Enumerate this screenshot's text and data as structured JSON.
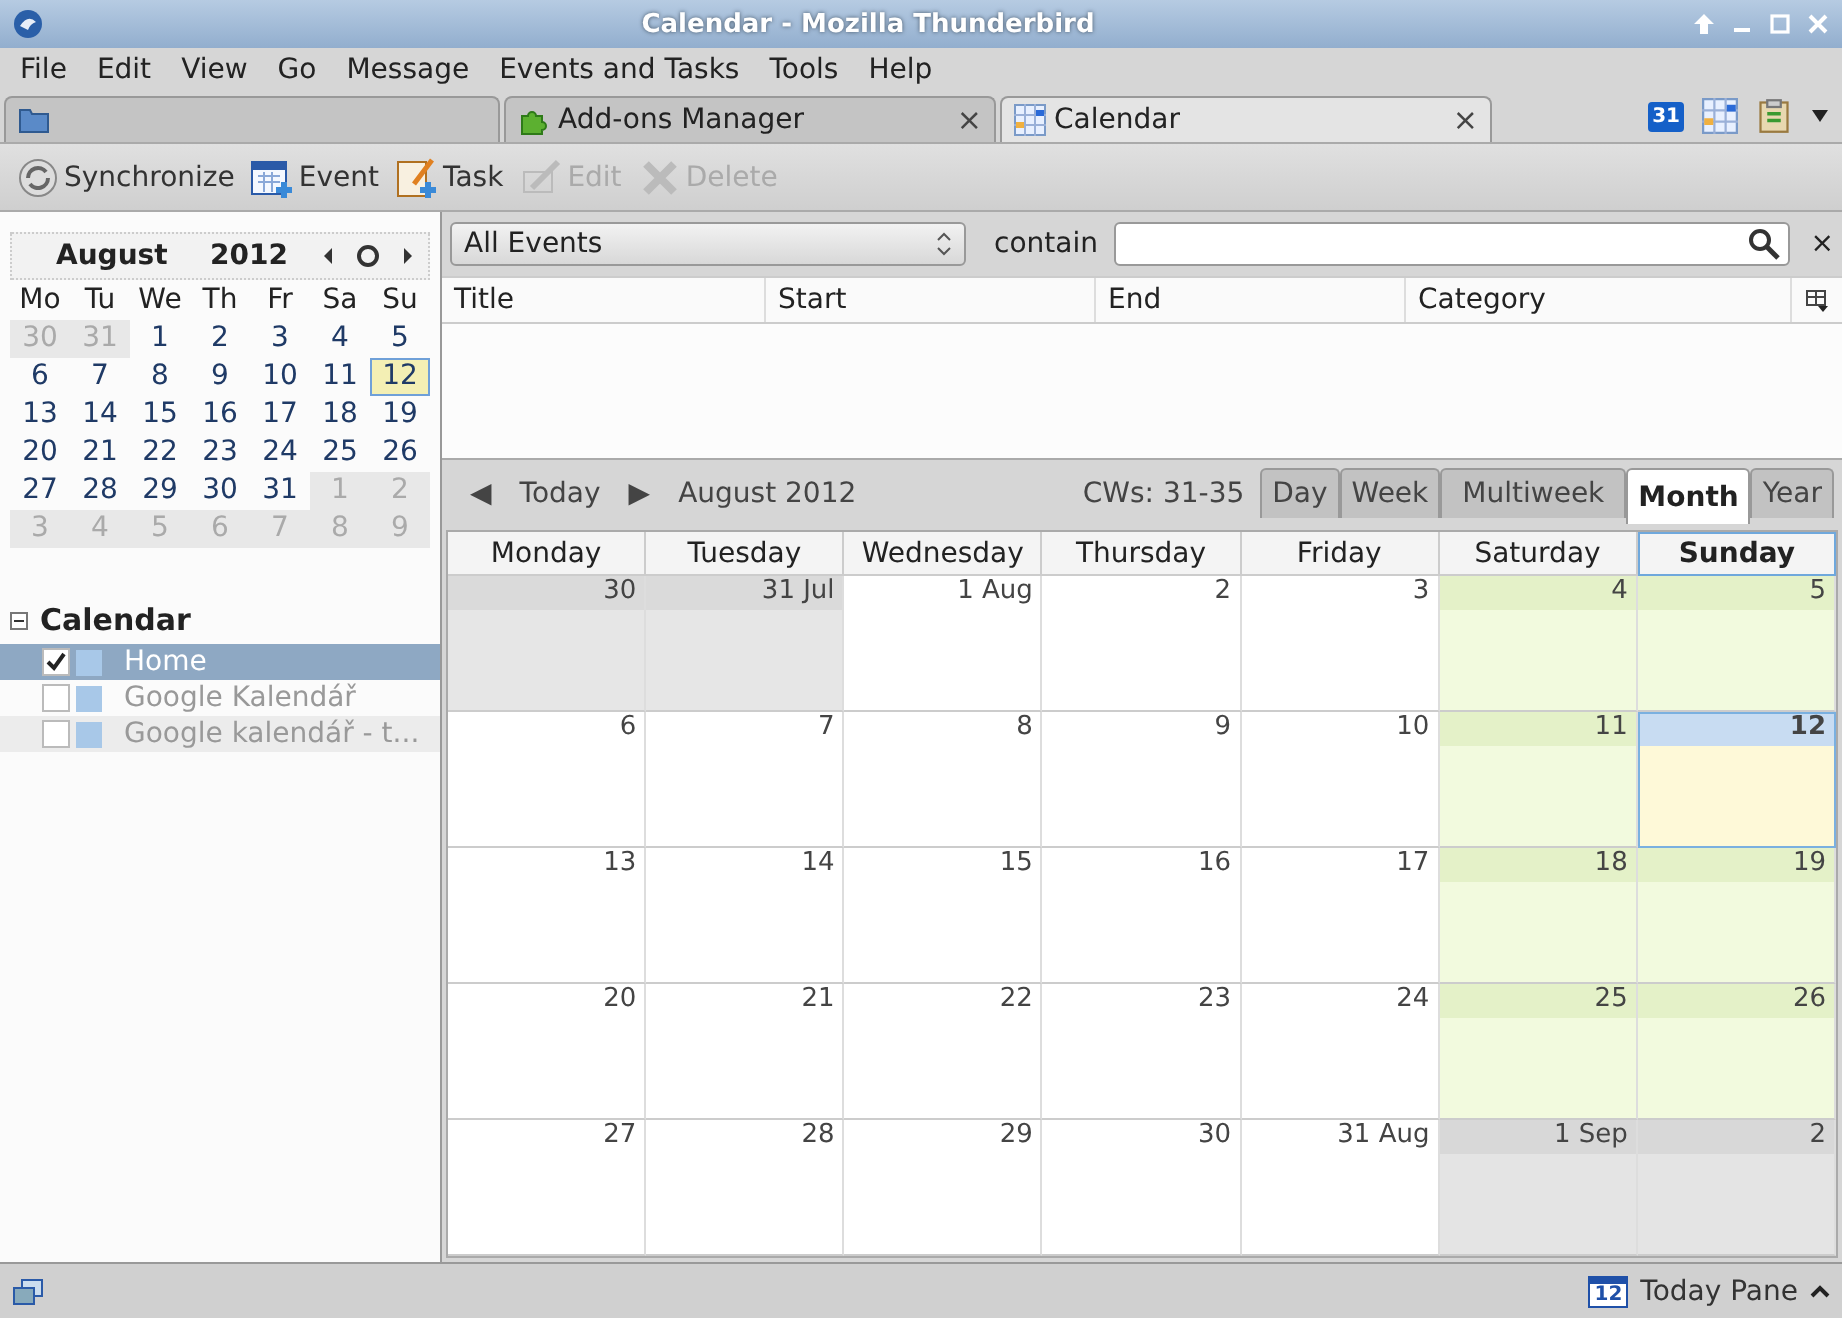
{
  "window": {
    "title": "Calendar - Mozilla Thunderbird"
  },
  "menu": [
    "File",
    "Edit",
    "View",
    "Go",
    "Message",
    "Events and Tasks",
    "Tools",
    "Help"
  ],
  "tabs": [
    {
      "kind": "folder",
      "selected": false
    },
    {
      "kind": "addons",
      "label": "Add-ons Manager",
      "close": "×",
      "selected": false
    },
    {
      "kind": "calendar",
      "label": "Calendar",
      "close": "×",
      "selected": true
    }
  ],
  "tab_tools": {
    "calendar_icon_text": "31"
  },
  "toolbar": [
    {
      "kind": "sync",
      "label": "Synchronize",
      "disabled": false
    },
    {
      "kind": "event",
      "label": "Event",
      "disabled": false
    },
    {
      "kind": "task",
      "label": "Task",
      "disabled": false
    },
    {
      "kind": "edit",
      "label": "Edit",
      "disabled": true
    },
    {
      "kind": "delete",
      "label": "Delete",
      "disabled": true
    }
  ],
  "minimonth": {
    "month": "August",
    "year": "2012",
    "weekdays": [
      "Mo",
      "Tu",
      "We",
      "Th",
      "Fr",
      "Sa",
      "Su"
    ],
    "weeks": [
      [
        {
          "d": "30",
          "other": true,
          "selected": false
        },
        {
          "d": "31",
          "other": true,
          "selected": false
        },
        {
          "d": "1",
          "other": false,
          "selected": false
        },
        {
          "d": "2",
          "other": false,
          "selected": false
        },
        {
          "d": "3",
          "other": false,
          "selected": false
        },
        {
          "d": "4",
          "other": false,
          "selected": false
        },
        {
          "d": "5",
          "other": false,
          "selected": false
        }
      ],
      [
        {
          "d": "6",
          "other": false,
          "selected": false
        },
        {
          "d": "7",
          "other": false,
          "selected": false
        },
        {
          "d": "8",
          "other": false,
          "selected": false
        },
        {
          "d": "9",
          "other": false,
          "selected": false
        },
        {
          "d": "10",
          "other": false,
          "selected": false
        },
        {
          "d": "11",
          "other": false,
          "selected": false
        },
        {
          "d": "12",
          "other": false,
          "selected": true
        }
      ],
      [
        {
          "d": "13",
          "other": false,
          "selected": false
        },
        {
          "d": "14",
          "other": false,
          "selected": false
        },
        {
          "d": "15",
          "other": false,
          "selected": false
        },
        {
          "d": "16",
          "other": false,
          "selected": false
        },
        {
          "d": "17",
          "other": false,
          "selected": false
        },
        {
          "d": "18",
          "other": false,
          "selected": false
        },
        {
          "d": "19",
          "other": false,
          "selected": false
        }
      ],
      [
        {
          "d": "20",
          "other": false,
          "selected": false
        },
        {
          "d": "21",
          "other": false,
          "selected": false
        },
        {
          "d": "22",
          "other": false,
          "selected": false
        },
        {
          "d": "23",
          "other": false,
          "selected": false
        },
        {
          "d": "24",
          "other": false,
          "selected": false
        },
        {
          "d": "25",
          "other": false,
          "selected": false
        },
        {
          "d": "26",
          "other": false,
          "selected": false
        }
      ],
      [
        {
          "d": "27",
          "other": false,
          "selected": false
        },
        {
          "d": "28",
          "other": false,
          "selected": false
        },
        {
          "d": "29",
          "other": false,
          "selected": false
        },
        {
          "d": "30",
          "other": false,
          "selected": false
        },
        {
          "d": "31",
          "other": false,
          "selected": false
        },
        {
          "d": "1",
          "other": true,
          "selected": false
        },
        {
          "d": "2",
          "other": true,
          "selected": false
        }
      ],
      [
        {
          "d": "3",
          "other": true,
          "selected": false
        },
        {
          "d": "4",
          "other": true,
          "selected": false
        },
        {
          "d": "5",
          "other": true,
          "selected": false
        },
        {
          "d": "6",
          "other": true,
          "selected": false
        },
        {
          "d": "7",
          "other": true,
          "selected": false
        },
        {
          "d": "8",
          "other": true,
          "selected": false
        },
        {
          "d": "9",
          "other": true,
          "selected": false
        }
      ]
    ]
  },
  "calendars": {
    "title": "Calendar",
    "expanded": true,
    "items": [
      {
        "label": "Home",
        "checked": true,
        "selected": true,
        "disabled": false,
        "color": "#a8c8e8"
      },
      {
        "label": "Google Kalendář",
        "checked": false,
        "selected": false,
        "disabled": true,
        "color": "#a8c8e8"
      },
      {
        "label": "Google kalendář - t...",
        "checked": false,
        "selected": false,
        "disabled": true,
        "color": "#a8c8e8"
      }
    ]
  },
  "filter": {
    "value": "All Events",
    "label": "contain",
    "close": "×"
  },
  "columns": [
    "Title",
    "Start",
    "End",
    "Category"
  ],
  "nav": {
    "prev": "◀",
    "today": "Today",
    "next": "▶",
    "period": "August 2012",
    "weeks": "CWs: 31-35",
    "views": [
      {
        "label": "Day",
        "selected": false
      },
      {
        "label": "Week",
        "selected": false
      },
      {
        "label": "Multiweek",
        "selected": false
      },
      {
        "label": "Month",
        "selected": true
      },
      {
        "label": "Year",
        "selected": false
      }
    ]
  },
  "month": {
    "weekdays": [
      {
        "label": "Monday",
        "selected": false
      },
      {
        "label": "Tuesday",
        "selected": false
      },
      {
        "label": "Wednesday",
        "selected": false
      },
      {
        "label": "Thursday",
        "selected": false
      },
      {
        "label": "Friday",
        "selected": false
      },
      {
        "label": "Saturday",
        "selected": false
      },
      {
        "label": "Sunday",
        "selected": true
      }
    ],
    "weeks": [
      [
        {
          "d": "30",
          "other": true,
          "weekend": false,
          "selected": false
        },
        {
          "d": "31 Jul",
          "other": true,
          "weekend": false,
          "selected": false
        },
        {
          "d": "1 Aug",
          "other": false,
          "weekend": false,
          "selected": false
        },
        {
          "d": "2",
          "other": false,
          "weekend": false,
          "selected": false
        },
        {
          "d": "3",
          "other": false,
          "weekend": false,
          "selected": false
        },
        {
          "d": "4",
          "other": false,
          "weekend": true,
          "selected": false
        },
        {
          "d": "5",
          "other": false,
          "weekend": true,
          "selected": false
        }
      ],
      [
        {
          "d": "6",
          "other": false,
          "weekend": false,
          "selected": false
        },
        {
          "d": "7",
          "other": false,
          "weekend": false,
          "selected": false
        },
        {
          "d": "8",
          "other": false,
          "weekend": false,
          "selected": false
        },
        {
          "d": "9",
          "other": false,
          "weekend": false,
          "selected": false
        },
        {
          "d": "10",
          "other": false,
          "weekend": false,
          "selected": false
        },
        {
          "d": "11",
          "other": false,
          "weekend": true,
          "selected": false
        },
        {
          "d": "12",
          "other": false,
          "weekend": true,
          "selected": true
        }
      ],
      [
        {
          "d": "13",
          "other": false,
          "weekend": false,
          "selected": false
        },
        {
          "d": "14",
          "other": false,
          "weekend": false,
          "selected": false
        },
        {
          "d": "15",
          "other": false,
          "weekend": false,
          "selected": false
        },
        {
          "d": "16",
          "other": false,
          "weekend": false,
          "selected": false
        },
        {
          "d": "17",
          "other": false,
          "weekend": false,
          "selected": false
        },
        {
          "d": "18",
          "other": false,
          "weekend": true,
          "selected": false
        },
        {
          "d": "19",
          "other": false,
          "weekend": true,
          "selected": false
        }
      ],
      [
        {
          "d": "20",
          "other": false,
          "weekend": false,
          "selected": false
        },
        {
          "d": "21",
          "other": false,
          "weekend": false,
          "selected": false
        },
        {
          "d": "22",
          "other": false,
          "weekend": false,
          "selected": false
        },
        {
          "d": "23",
          "other": false,
          "weekend": false,
          "selected": false
        },
        {
          "d": "24",
          "other": false,
          "weekend": false,
          "selected": false
        },
        {
          "d": "25",
          "other": false,
          "weekend": true,
          "selected": false
        },
        {
          "d": "26",
          "other": false,
          "weekend": true,
          "selected": false
        }
      ],
      [
        {
          "d": "27",
          "other": false,
          "weekend": false,
          "selected": false
        },
        {
          "d": "28",
          "other": false,
          "weekend": false,
          "selected": false
        },
        {
          "d": "29",
          "other": false,
          "weekend": false,
          "selected": false
        },
        {
          "d": "30",
          "other": false,
          "weekend": false,
          "selected": false
        },
        {
          "d": "31 Aug",
          "other": false,
          "weekend": false,
          "selected": false
        },
        {
          "d": "1 Sep",
          "other": true,
          "weekend": true,
          "selected": false
        },
        {
          "d": "2",
          "other": true,
          "weekend": true,
          "selected": false
        }
      ]
    ]
  },
  "status_bar": {
    "today_icon_text": "12",
    "today_pane": "Today Pane"
  }
}
